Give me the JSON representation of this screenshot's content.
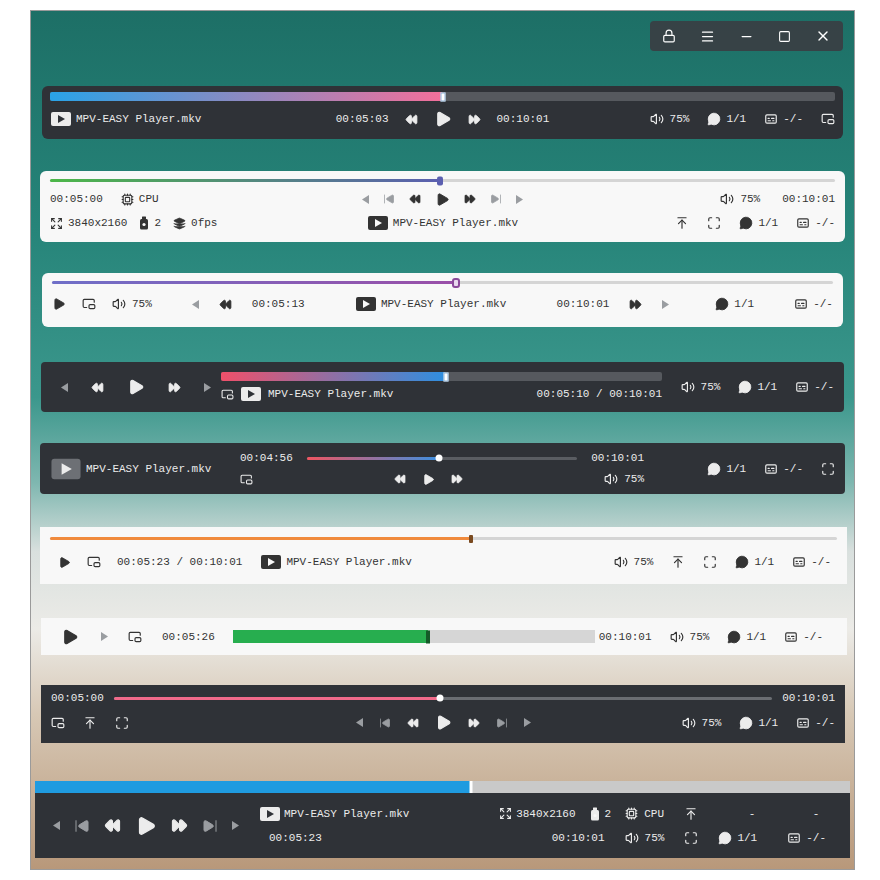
{
  "osc_bars": [
    {
      "kind": "classic",
      "file": "MPV-EASY Player.mkv",
      "position": "00:05:03",
      "duration": "00:10:01",
      "volume": "75%",
      "subtitle": "1/1",
      "audio": "-/-",
      "progress": {
        "level": 0.5,
        "color": "#29a3e8",
        "color_end": "#f36f9a"
      }
    },
    {
      "kind": "detailed",
      "file": "MPV-EASY Player.mkv",
      "position": "00:05:00",
      "duration": "00:10:01",
      "hwdec": "CPU",
      "resolution": "3840x2160",
      "cache": "2",
      "fps": "0fps",
      "volume": "75%",
      "subtitle": "1/1",
      "audio": "-/-",
      "progress": {
        "level": 0.497,
        "color": "#4cb748",
        "color_end": "#5b5fb0"
      }
    },
    {
      "kind": "single-row",
      "file": "MPV-EASY Player.mkv",
      "position": "00:05:13",
      "duration": "00:10:01",
      "volume": "75%",
      "subtitle": "1/1",
      "audio": "-/-",
      "progress": {
        "level": 0.517,
        "color": "#6f6fc8",
        "color_end": "#9a4fa8"
      }
    },
    {
      "kind": "split-left",
      "file": "MPV-EASY Player.mkv",
      "time": "00:05:10 / 00:10:01",
      "volume": "75%",
      "subtitle": "1/1",
      "audio": "-/-",
      "progress": {
        "level": 0.51,
        "color": "#f0506a",
        "color_end": "#2e8fe0"
      }
    },
    {
      "kind": "compact-center",
      "file": "MPV-EASY Player.mkv",
      "position": "00:04:56",
      "duration": "00:10:01",
      "volume": "75%",
      "subtitle": "1/1",
      "audio": "-/-",
      "progress": {
        "level": 0.49,
        "color": "#ef5561",
        "color_end": "#3d8fe0"
      }
    },
    {
      "kind": "strip",
      "file": "MPV-EASY Player.mkv",
      "time": "00:05:23 / 00:10:01",
      "volume": "75%",
      "subtitle": "1/1",
      "audio": "-/-",
      "progress": {
        "level": 0.535,
        "color": "#f08a3c",
        "color_end": "#f08a3c"
      }
    },
    {
      "kind": "inline",
      "position": "00:05:26",
      "duration": "00:10:01",
      "volume": "75%",
      "subtitle": "1/1",
      "audio": "-/-",
      "progress": {
        "level": 0.54,
        "color": "#27ae4f",
        "color_end": "#27ae4f"
      }
    },
    {
      "kind": "two-row",
      "position": "00:05:00",
      "duration": "00:10:01",
      "volume": "75%",
      "subtitle": "1/1",
      "audio": "-/-",
      "progress": {
        "level": 0.496,
        "color": "#f06a8a",
        "color_end": "#f06a8a"
      }
    },
    {
      "kind": "full-width",
      "file": "MPV-EASY Player.mkv",
      "position": "00:05:23",
      "duration": "00:10:01",
      "resolution": "3840x2160",
      "cache": "2",
      "hwdec": "CPU",
      "extras": [
        "-",
        "-"
      ],
      "volume": "75%",
      "subtitle": "1/1",
      "audio": "-/-",
      "progress": {
        "level": 0.535,
        "color": "#1f9be0",
        "color_end": "#1f9be0"
      }
    }
  ]
}
